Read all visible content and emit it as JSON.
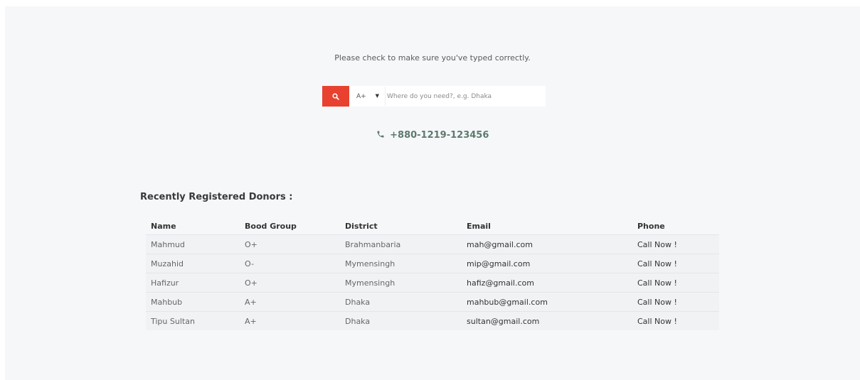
{
  "search_section": {
    "hint": "Please check to make sure you've typed correctly.",
    "blood_group_value": "A+",
    "location_placeholder": "Where do you need?, e.g. Dhaka",
    "accent_color": "#e8412f",
    "search_icon": "search-icon",
    "dropdown_icon": "caret-down-icon"
  },
  "contact": {
    "phone_icon": "phone-icon",
    "phone": "+880-1219-123456"
  },
  "donors": {
    "title": "Recently Registered Donors :",
    "columns": [
      "Name",
      "Bood Group",
      "District",
      "Email",
      "Phone"
    ],
    "rows": [
      {
        "name": "Mahmud",
        "group": "O+",
        "district": "Brahmanbaria",
        "email": "mah@gmail.com",
        "phone": "Call Now !"
      },
      {
        "name": "Muzahid",
        "group": "O-",
        "district": "Mymensingh",
        "email": "mip@gmail.com",
        "phone": "Call Now !"
      },
      {
        "name": "Hafizur",
        "group": "O+",
        "district": "Mymensingh",
        "email": "hafiz@gmail.com",
        "phone": "Call Now !"
      },
      {
        "name": "Mahbub",
        "group": "A+",
        "district": "Dhaka",
        "email": "mahbub@gmail.com",
        "phone": "Call Now !"
      },
      {
        "name": "Tipu Sultan",
        "group": "A+",
        "district": "Dhaka",
        "email": "sultan@gmail.com",
        "phone": "Call Now !"
      }
    ]
  }
}
